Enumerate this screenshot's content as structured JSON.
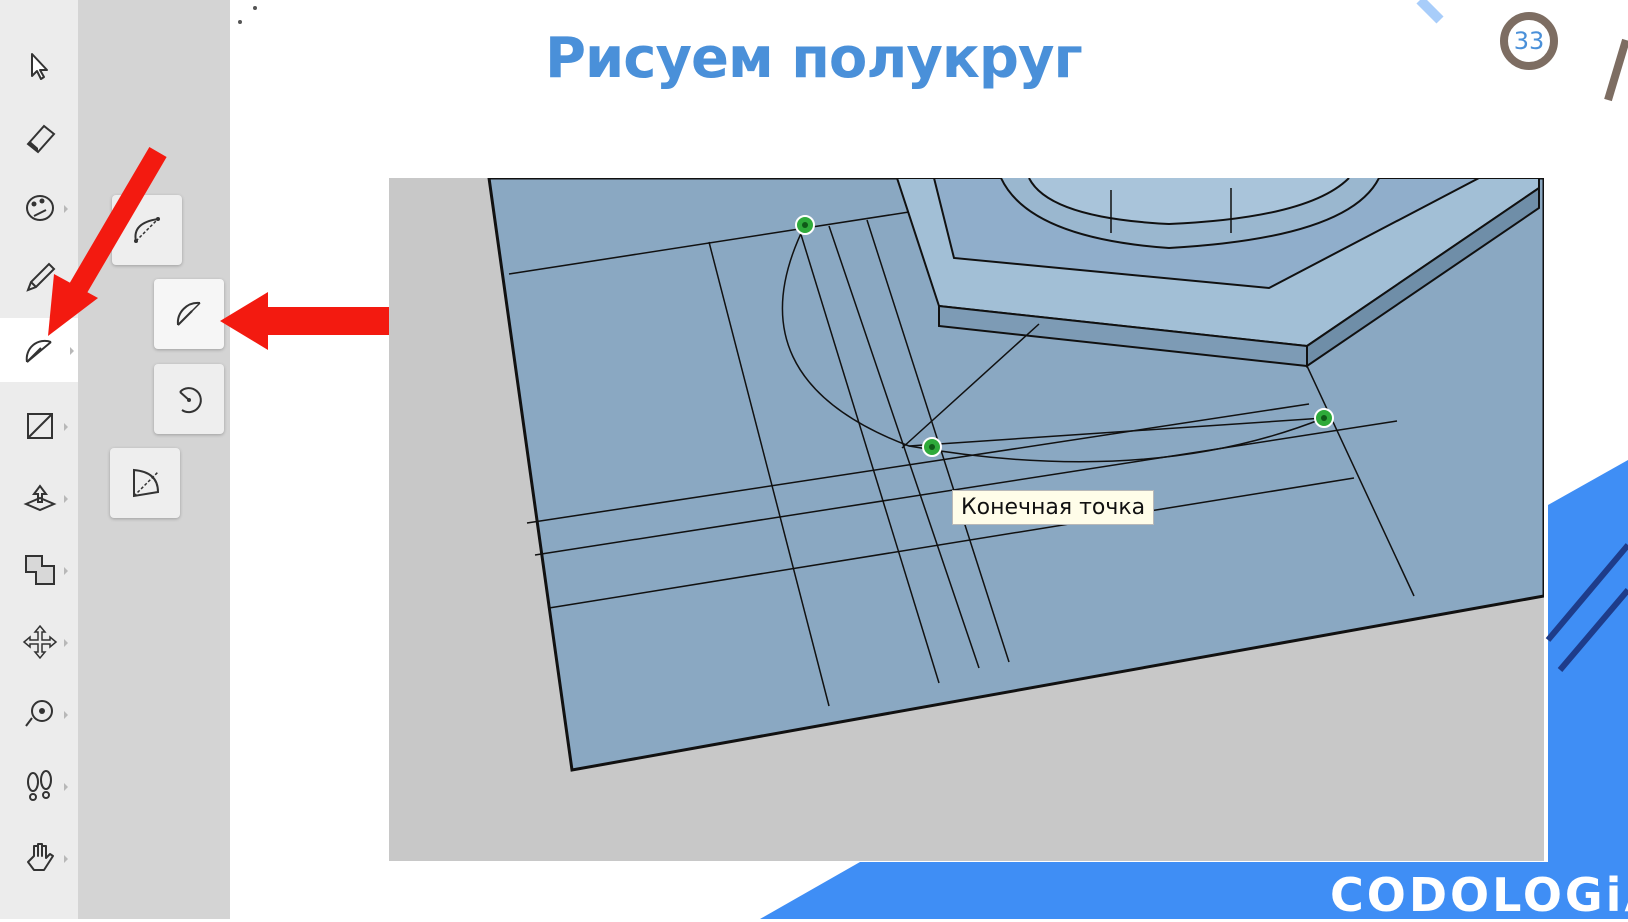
{
  "slide": {
    "title": "Рисуем полукруг",
    "page_number": "33",
    "brand": "CODOLOGiA"
  },
  "toolbar": {
    "tools": [
      {
        "name": "select-icon"
      },
      {
        "name": "eraser-icon"
      },
      {
        "name": "paint-bucket-icon"
      },
      {
        "name": "pencil-icon"
      },
      {
        "name": "arc-tool-icon",
        "active": true
      },
      {
        "name": "rectangle-icon"
      },
      {
        "name": "push-pull-icon"
      },
      {
        "name": "offset-icon"
      },
      {
        "name": "move-icon"
      },
      {
        "name": "tape-measure-icon"
      },
      {
        "name": "walk-icon"
      },
      {
        "name": "hand-icon"
      }
    ],
    "flyout": [
      {
        "name": "two-point-arc-icon"
      },
      {
        "name": "arc-icon",
        "selected": true
      },
      {
        "name": "rotate-arc-icon"
      },
      {
        "name": "pie-icon"
      }
    ]
  },
  "viewport": {
    "tooltip": "Конечная точка"
  },
  "colors": {
    "title": "#4a90d9",
    "annotation_arrow": "#f31a10",
    "model_face": "#8aa8c2",
    "model_face_light": "#a8c3da",
    "inference_point": "#2eaa3a",
    "brand_accent": "#3f8ef5"
  }
}
